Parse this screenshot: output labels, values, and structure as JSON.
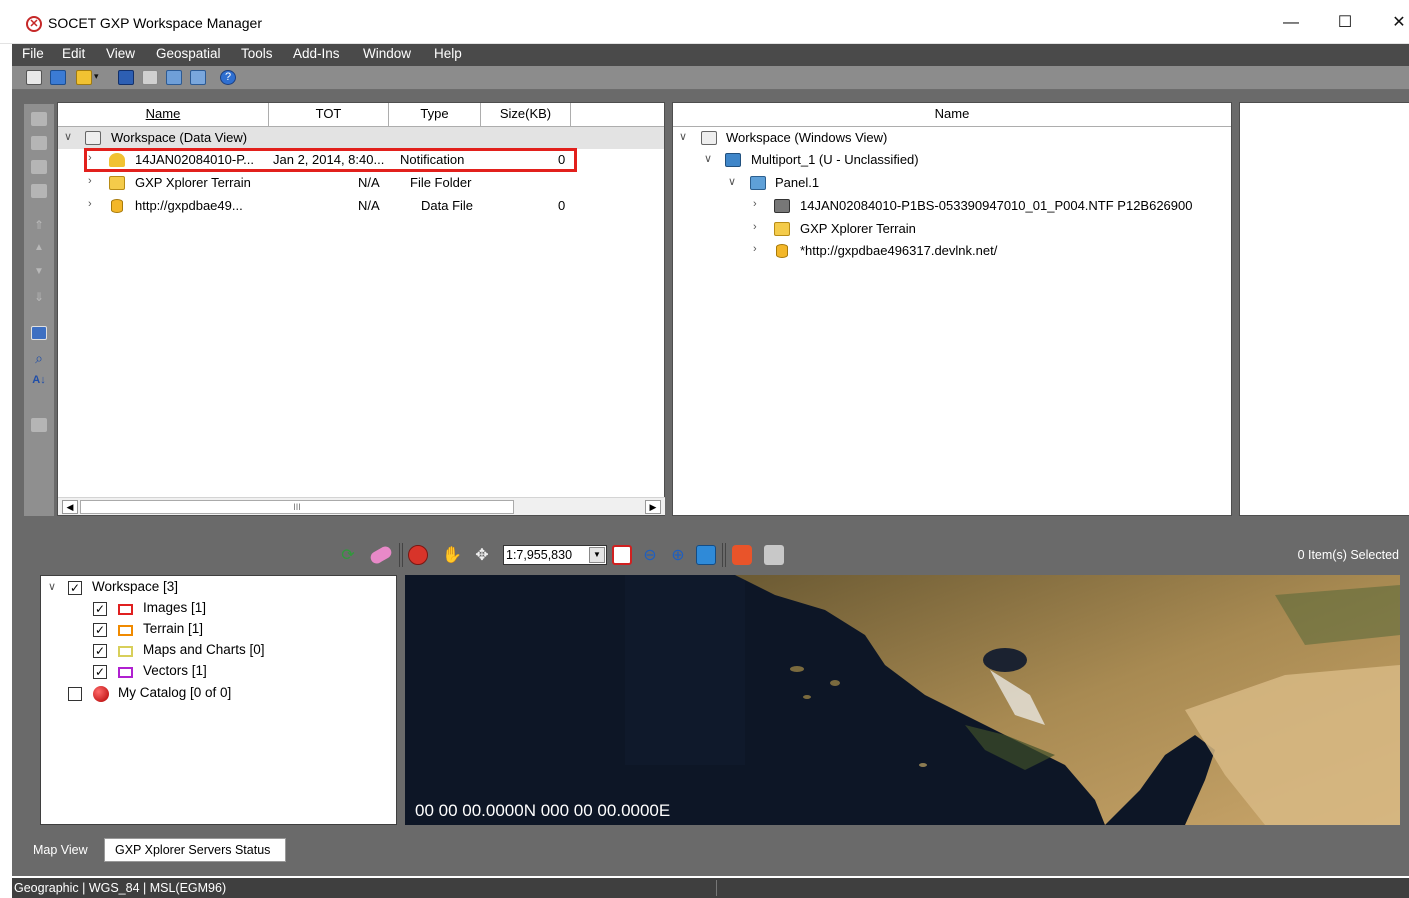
{
  "window": {
    "title": "SOCET GXP Workspace Manager",
    "minimize": "—",
    "maximize": "☐",
    "close": "✕"
  },
  "menu": [
    "File",
    "Edit",
    "View",
    "Geospatial",
    "Tools",
    "Add-Ins",
    "Window",
    "Help"
  ],
  "data_view": {
    "columns": [
      "Name",
      "TOT",
      "Type",
      "Size(KB)"
    ],
    "root": "Workspace (Data View)",
    "rows": [
      {
        "name": "14JAN02084010-P...",
        "tot": "Jan 2, 2014, 8:40...",
        "type": "Notification",
        "size": "0"
      },
      {
        "name": "GXP Xplorer Terrain",
        "tot": "N/A",
        "type": "File Folder",
        "size": ""
      },
      {
        "name": "http://gxpdbae49...",
        "tot": "N/A",
        "type": "Data File",
        "size": "0"
      }
    ],
    "scroll_thumb": "III"
  },
  "windows_view": {
    "column": "Name",
    "root": "Workspace (Windows View)",
    "multiport": "Multiport_1 (U - Unclassified)",
    "panel": "Panel.1",
    "items": [
      "14JAN02084010-P1BS-053390947010_01_P004.NTF P12B626900",
      "GXP Xplorer Terrain",
      "*http://gxpdbae496317.devlnk.net/"
    ]
  },
  "map_toolbar": {
    "scale": "1:7,955,830",
    "selected": "0 Item(s) Selected"
  },
  "layers": {
    "workspace": "Workspace [3]",
    "items": [
      {
        "label": "Images [1]",
        "color": "#e02020"
      },
      {
        "label": "Terrain [1]",
        "color": "#f08a00"
      },
      {
        "label": "Maps and Charts [0]",
        "color": "#d8cf5a"
      },
      {
        "label": "Vectors [1]",
        "color": "#b020d0"
      }
    ],
    "catalog": "My Catalog [0 of 0]"
  },
  "map": {
    "coordinates": "00 00 00.0000N 000 00 00.0000E"
  },
  "tabs": [
    "Map View",
    "GXP Xplorer Servers Status"
  ],
  "status": "Geographic | WGS_84 | MSL(EGM96)"
}
